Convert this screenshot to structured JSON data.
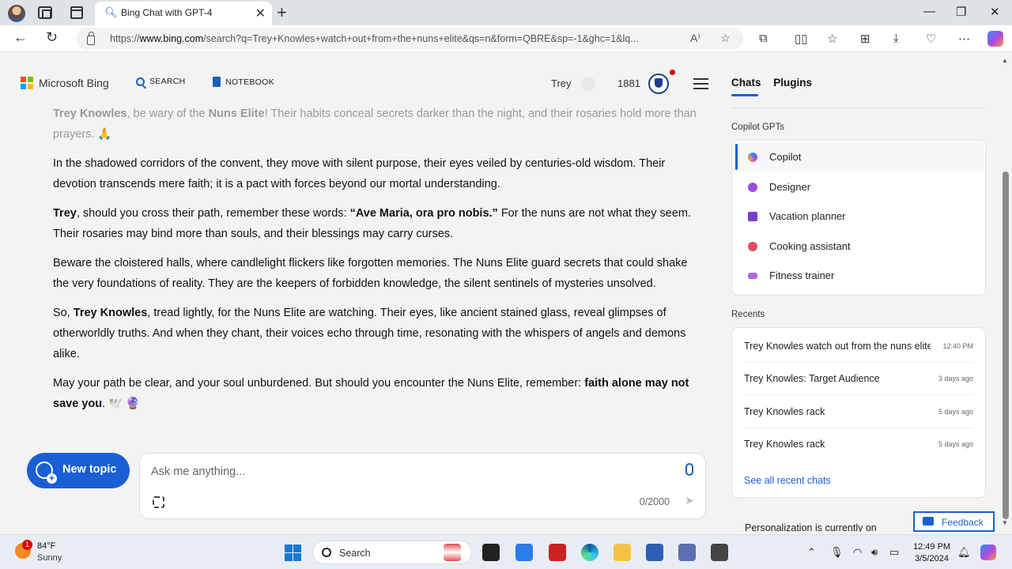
{
  "browser": {
    "tab_title": "Bing Chat with GPT-4",
    "url_prefix": "https://",
    "url_host": "www.bing.com",
    "url_rest": "/search?q=Trey+Knowles+watch+out+from+the+nuns+elite&qs=n&form=QBRE&sp=-1&ghc=1&lq..."
  },
  "header": {
    "brand": "Microsoft Bing",
    "search_label": "SEARCH",
    "notebook_label": "NOTEBOOK",
    "user_name": "Trey",
    "points": "1881"
  },
  "chat": {
    "p1": {
      "b1": "Trey Knowles",
      "t1": ", be wary of the ",
      "b2": "Nuns Elite",
      "t2": "! Their habits conceal secrets darker than the night, and their rosaries hold more than prayers. 🙏"
    },
    "p2": "In the shadowed corridors of the convent, they move with silent purpose, their eyes veiled by centuries-old wisdom. Their devotion transcends mere faith; it is a pact with forces beyond our mortal understanding.",
    "p3": {
      "b1": "Trey",
      "t1": ", should you cross their path, remember these words: ",
      "b2": "“Ave Maria, ora pro nobis.”",
      "t2": " For the nuns are not what they seem. Their rosaries may bind more than souls, and their blessings may carry curses."
    },
    "p4": "Beware the cloistered halls, where candlelight flickers like forgotten memories. The Nuns Elite guard secrets that could shake the very foundations of reality. They are the keepers of forbidden knowledge, the silent sentinels of mysteries unsolved.",
    "p5": {
      "t0": "So, ",
      "b1": "Trey Knowles",
      "t1": ", tread lightly, for the Nuns Elite are watching. Their eyes, like ancient stained glass, reveal glimpses of otherworldly truths. And when they chant, their voices echo through time, resonating with the whispers of angels and demons alike."
    },
    "p6": {
      "t0": "May your path be clear, and your soul unburdened. But should you encounter the Nuns Elite, remember: ",
      "b1": "faith alone may not save you",
      "t1": ". 🕊️ 🔮"
    }
  },
  "composer": {
    "new_topic": "New topic",
    "placeholder": "Ask me anything...",
    "char_count": "0/2000"
  },
  "panel": {
    "tab_chats": "Chats",
    "tab_plugins": "Plugins",
    "gpts_heading": "Copilot GPTs",
    "gpts": [
      {
        "label": "Copilot",
        "color": "#4a8cff"
      },
      {
        "label": "Designer",
        "color": "#9b4dd9"
      },
      {
        "label": "Vacation planner",
        "color": "#7a3fc9"
      },
      {
        "label": "Cooking assistant",
        "color": "#e04a6a"
      },
      {
        "label": "Fitness trainer",
        "color": "#b068d8"
      }
    ],
    "recents_heading": "Recents",
    "recents": [
      {
        "title": "Trey Knowles watch out from the nuns elite",
        "date": "12:40 PM"
      },
      {
        "title": "Trey Knowles: Target Audience",
        "date": "3 days ago"
      },
      {
        "title": "Trey Knowles rack",
        "date": "5 days ago"
      },
      {
        "title": "Trey Knowles rack",
        "date": "5 days ago"
      }
    ],
    "see_all": "See all recent chats",
    "personalization": "Personalization is currently on",
    "feedback": "Feedback"
  },
  "taskbar": {
    "temp": "84°F",
    "condition": "Sunny",
    "weather_badge": "1",
    "search": "Search",
    "time": "12:49 PM",
    "date": "3/5/2024"
  }
}
